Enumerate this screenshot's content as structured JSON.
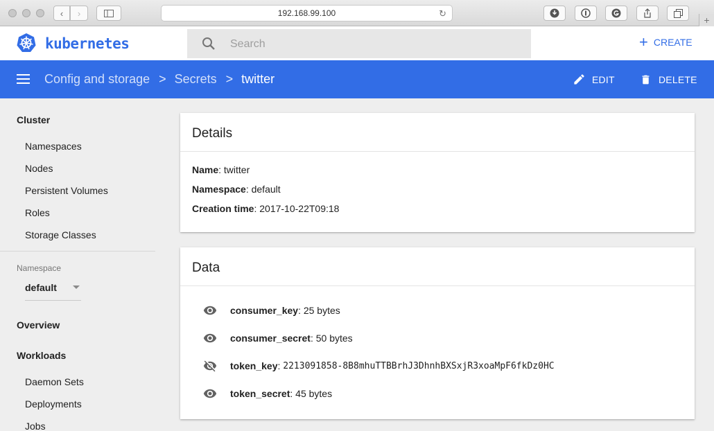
{
  "browser": {
    "url": "192.168.99.100"
  },
  "header": {
    "brand": "kubernetes",
    "search_placeholder": "Search",
    "create_label": "CREATE"
  },
  "toolbar": {
    "breadcrumbs": [
      "Config and storage",
      "Secrets"
    ],
    "current": "twitter",
    "edit_label": "EDIT",
    "delete_label": "DELETE"
  },
  "sidebar": {
    "cluster_heading": "Cluster",
    "cluster_items": [
      "Namespaces",
      "Nodes",
      "Persistent Volumes",
      "Roles",
      "Storage Classes"
    ],
    "namespace_label": "Namespace",
    "namespace_value": "default",
    "overview": "Overview",
    "workloads_heading": "Workloads",
    "workload_items": [
      "Daemon Sets",
      "Deployments",
      "Jobs"
    ]
  },
  "details": {
    "title": "Details",
    "rows": [
      {
        "label": "Name",
        "value": "twitter"
      },
      {
        "label": "Namespace",
        "value": "default"
      },
      {
        "label": "Creation time",
        "value": "2017-10-22T09:18"
      }
    ]
  },
  "data_card": {
    "title": "Data",
    "rows": [
      {
        "key": "consumer_key",
        "value": "25 bytes",
        "revealed": false
      },
      {
        "key": "consumer_secret",
        "value": "50 bytes",
        "revealed": false
      },
      {
        "key": "token_key",
        "value": "2213091858-8B8mhuTTBBrhJ3DhnhBXSxjR3xoaMpF6fkDz0HC",
        "revealed": true
      },
      {
        "key": "token_secret",
        "value": "45 bytes",
        "revealed": false
      }
    ]
  },
  "colors": {
    "primary": "#326de6",
    "background": "#eeeeee",
    "icon_grey": "#616161"
  }
}
